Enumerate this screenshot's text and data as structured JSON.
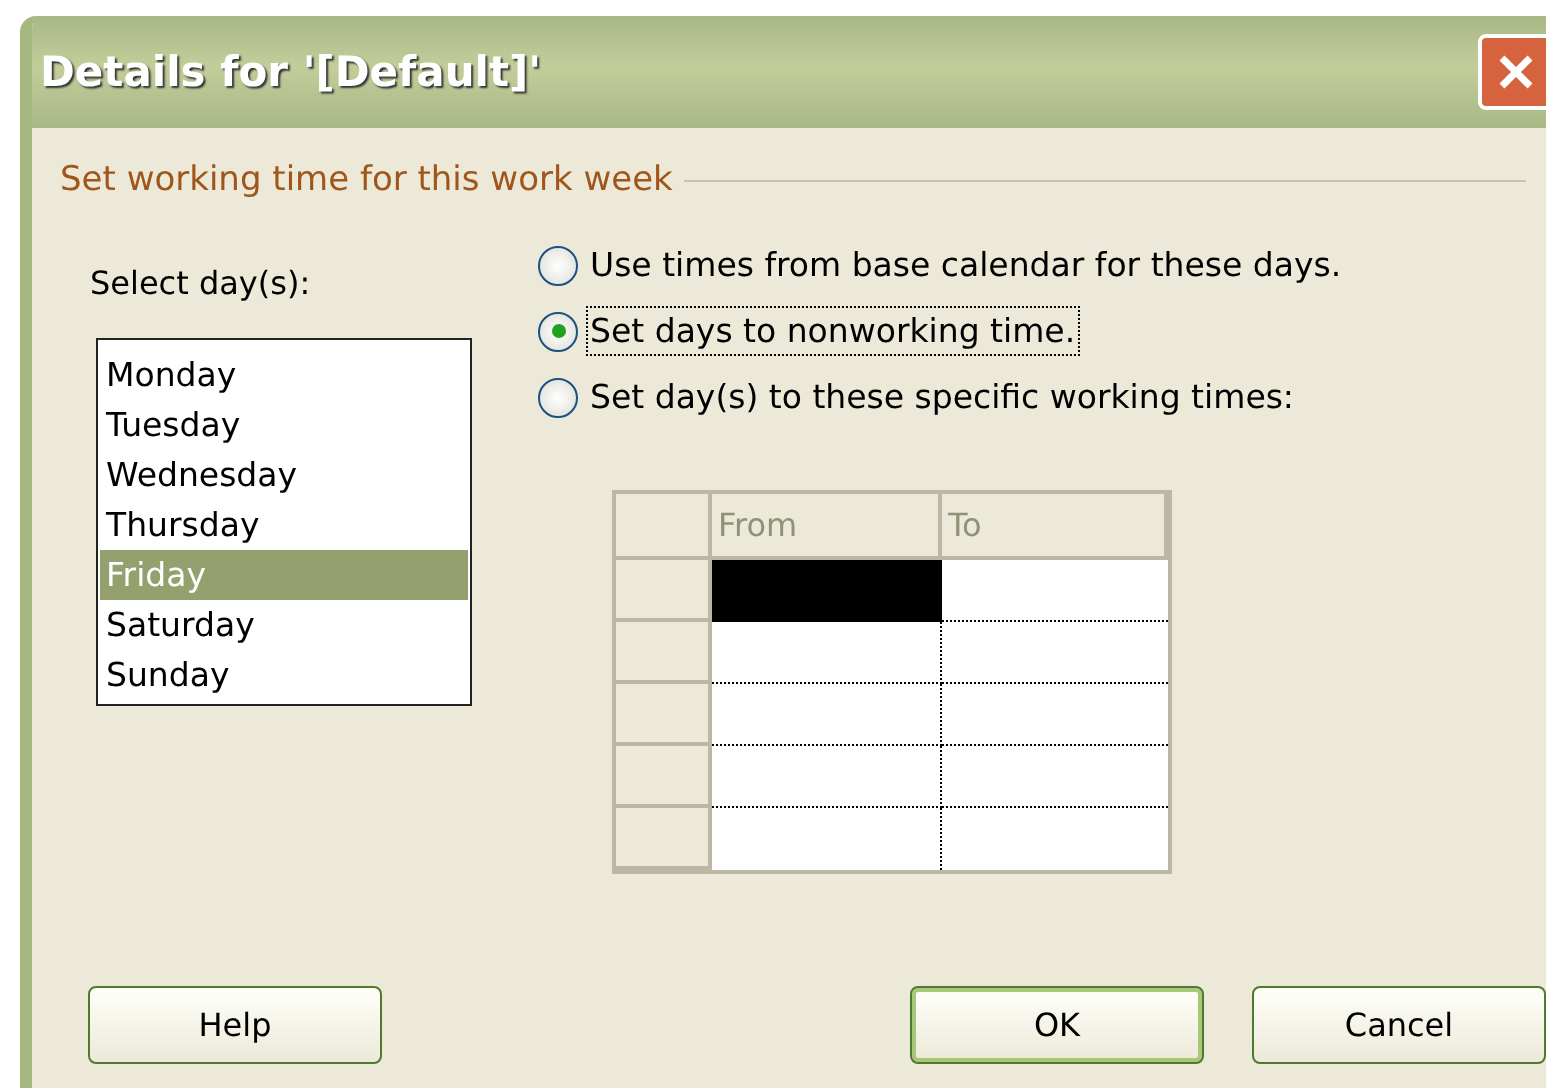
{
  "window": {
    "title": "Details for '[Default]'"
  },
  "group_label": "Set working time for this work week",
  "days_label": "Select day(s):",
  "days": [
    {
      "label": "Monday",
      "selected": false
    },
    {
      "label": "Tuesday",
      "selected": false
    },
    {
      "label": "Wednesday",
      "selected": false
    },
    {
      "label": "Thursday",
      "selected": false
    },
    {
      "label": "Friday",
      "selected": true
    },
    {
      "label": "Saturday",
      "selected": false
    },
    {
      "label": "Sunday",
      "selected": false
    }
  ],
  "options": [
    {
      "label": "Use times from base calendar for these days.",
      "selected": false
    },
    {
      "label": "Set days to nonworking time.",
      "selected": true
    },
    {
      "label": "Set day(s) to these specific working times:",
      "selected": false
    }
  ],
  "grid": {
    "columns": [
      "From",
      "To"
    ],
    "rows": [
      {
        "cells": [
          {
            "selected": true
          },
          {
            "selected": false
          }
        ]
      },
      {
        "cells": [
          {
            "selected": false
          },
          {
            "selected": false
          }
        ]
      },
      {
        "cells": [
          {
            "selected": false
          },
          {
            "selected": false
          }
        ]
      },
      {
        "cells": [
          {
            "selected": false
          },
          {
            "selected": false
          }
        ]
      },
      {
        "cells": [
          {
            "selected": false
          },
          {
            "selected": false
          }
        ]
      }
    ]
  },
  "buttons": [
    {
      "label": "Help",
      "default": false
    },
    {
      "label": "OK",
      "default": true
    },
    {
      "label": "Cancel",
      "default": false
    }
  ]
}
